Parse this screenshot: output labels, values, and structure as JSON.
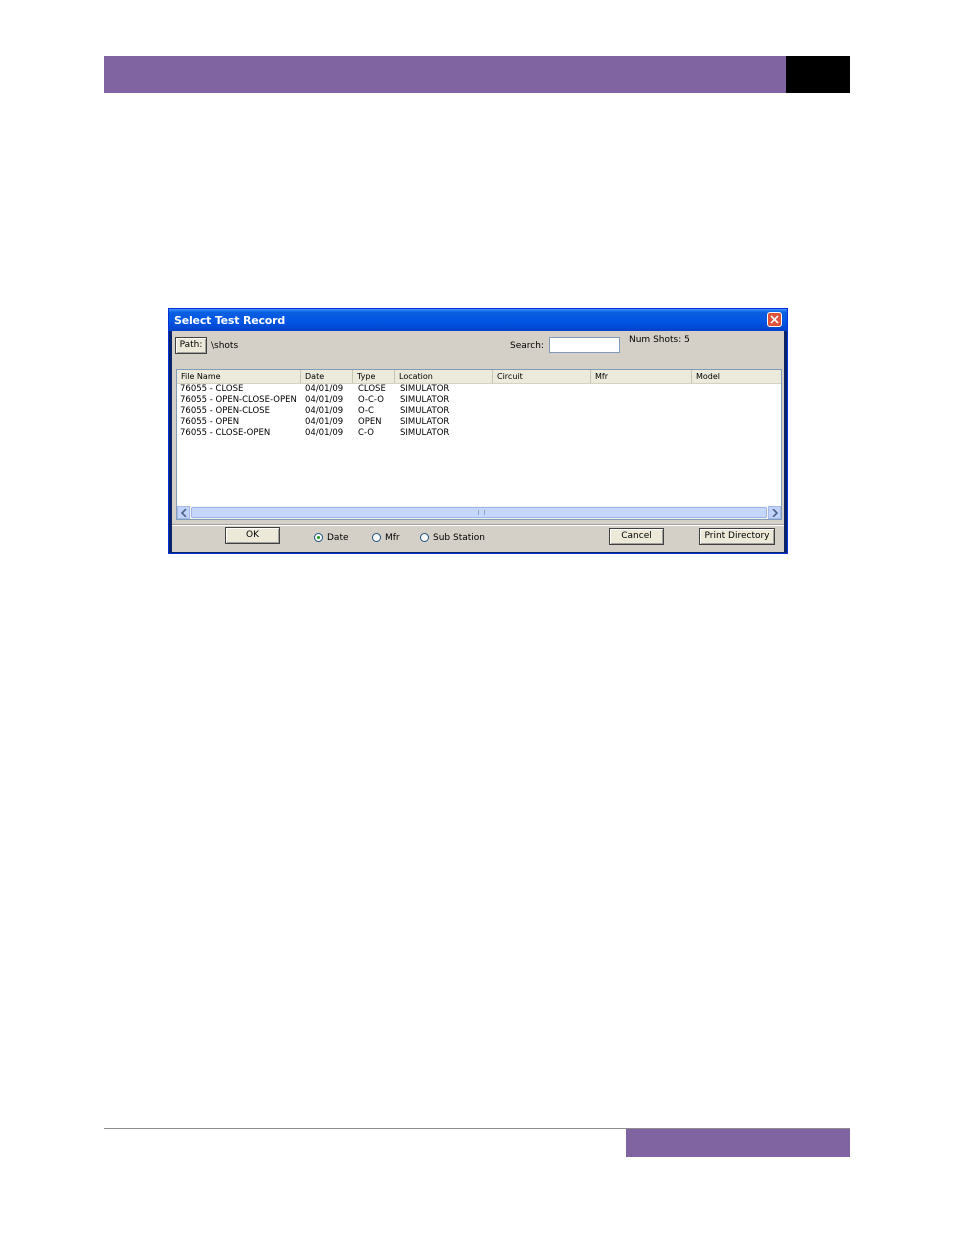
{
  "dialog": {
    "title": "Select Test Record",
    "path_button": "Path:",
    "path_value": "\\shots",
    "search_label": "Search:",
    "search_value": "",
    "num_shots": "Num Shots: 5"
  },
  "table": {
    "columns": [
      "File Name",
      "Date",
      "Type",
      "Location",
      "Circuit",
      "Mfr",
      "Model"
    ],
    "rows": [
      {
        "file": "76055 - CLOSE",
        "date": "04/01/09",
        "type": "CLOSE",
        "location": "SIMULATOR"
      },
      {
        "file": "76055 - OPEN-CLOSE-OPEN",
        "date": "04/01/09",
        "type": "O-C-O",
        "location": "SIMULATOR"
      },
      {
        "file": "76055 - OPEN-CLOSE",
        "date": "04/01/09",
        "type": "O-C",
        "location": "SIMULATOR"
      },
      {
        "file": "76055 - OPEN",
        "date": "04/01/09",
        "type": "OPEN",
        "location": "SIMULATOR"
      },
      {
        "file": "76055 - CLOSE-OPEN",
        "date": "04/01/09",
        "type": "C-O",
        "location": "SIMULATOR"
      }
    ]
  },
  "footer": {
    "ok_label": "OK",
    "sort_options": [
      "Date",
      "Mfr",
      "Sub Station"
    ],
    "sort_selected": "Date",
    "cancel_label": "Cancel",
    "print_label": "Print Directory"
  },
  "colors": {
    "accent_band": "#8064a2",
    "titlebar": "#0054e3"
  }
}
